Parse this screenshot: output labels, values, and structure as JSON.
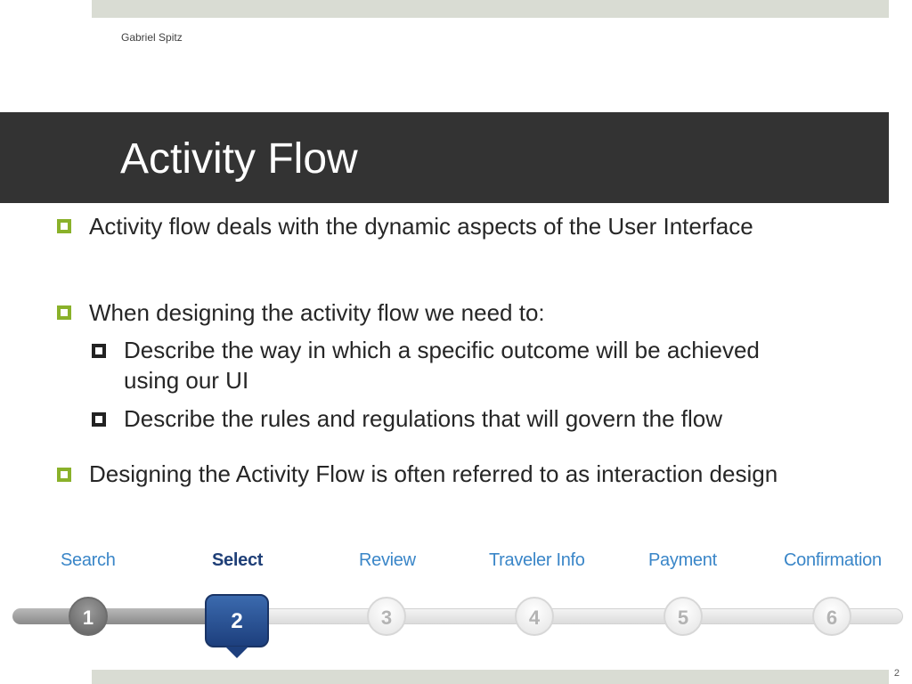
{
  "header": {
    "author": "Gabriel Spitz"
  },
  "slide": {
    "title": "Activity Flow",
    "bullets": [
      {
        "text": "Activity flow deals with the dynamic aspects of the User Interface"
      },
      {
        "text": "When designing the activity flow we need to:",
        "sub": [
          "Describe the way in which a specific outcome will be achieved using our UI",
          "Describe the rules and regulations that will govern the flow"
        ]
      },
      {
        "text": "Designing the Activity Flow is often referred to as interaction design"
      }
    ],
    "page_number": "2"
  },
  "stepper": {
    "steps": [
      {
        "label": "Search",
        "number": "1",
        "state": "done"
      },
      {
        "label": "Select",
        "number": "2",
        "state": "active"
      },
      {
        "label": "Review",
        "number": "3",
        "state": "todo"
      },
      {
        "label": "Traveler Info",
        "number": "4",
        "state": "todo"
      },
      {
        "label": "Payment",
        "number": "5",
        "state": "todo"
      },
      {
        "label": "Confirmation",
        "number": "6",
        "state": "todo"
      }
    ],
    "current_step": 2
  },
  "colors": {
    "title_bar": "#333333",
    "bullet_accent": "#8ab12a",
    "step_label": "#3a86c8",
    "active_step": "#1d3f7d"
  }
}
